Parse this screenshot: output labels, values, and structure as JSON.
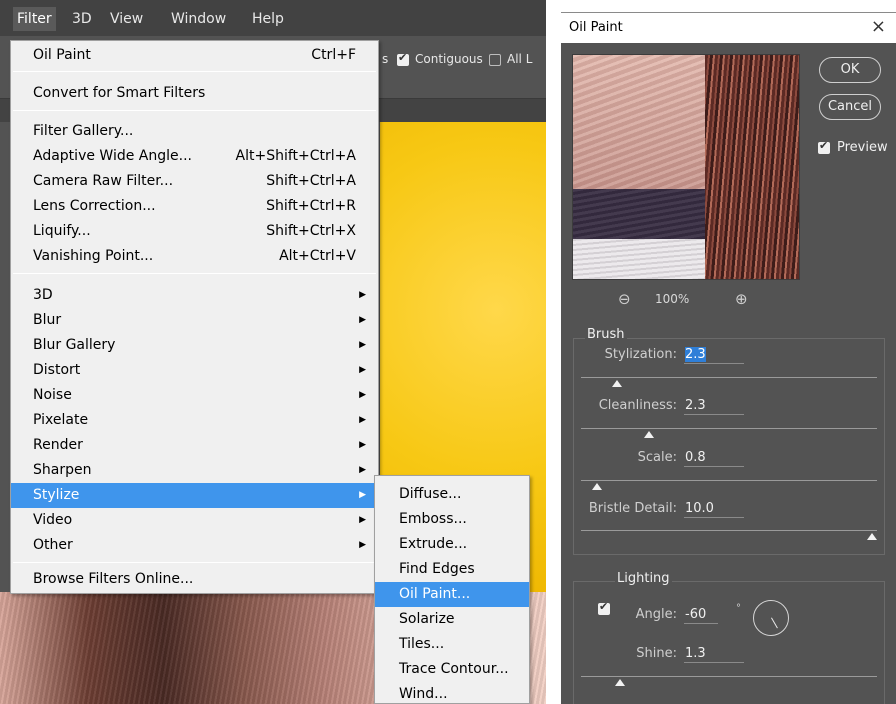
{
  "menubar": {
    "items": [
      "Filter",
      "3D",
      "View",
      "Window",
      "Help"
    ]
  },
  "options_bar": {
    "partial_text": "s",
    "contiguous_label": "Contiguous",
    "all_layers_partial": "All L"
  },
  "filter_menu": {
    "oil_paint": {
      "label": "Oil Paint",
      "shortcut": "Ctrl+F"
    },
    "convert_smart": "Convert for Smart Filters",
    "filter_gallery": "Filter Gallery...",
    "adaptive_wide_angle": {
      "label": "Adaptive Wide Angle...",
      "shortcut": "Alt+Shift+Ctrl+A"
    },
    "camera_raw": {
      "label": "Camera Raw Filter...",
      "shortcut": "Shift+Ctrl+A"
    },
    "lens_correction": {
      "label": "Lens Correction...",
      "shortcut": "Shift+Ctrl+R"
    },
    "liquify": {
      "label": "Liquify...",
      "shortcut": "Shift+Ctrl+X"
    },
    "vanishing_point": {
      "label": "Vanishing Point...",
      "shortcut": "Alt+Ctrl+V"
    },
    "submenus": [
      "3D",
      "Blur",
      "Blur Gallery",
      "Distort",
      "Noise",
      "Pixelate",
      "Render",
      "Sharpen",
      "Stylize",
      "Video",
      "Other"
    ],
    "browse_online": "Browse Filters Online..."
  },
  "stylize_submenu": {
    "items": [
      "Diffuse...",
      "Emboss...",
      "Extrude...",
      "Find Edges",
      "Oil Paint...",
      "Solarize",
      "Tiles...",
      "Trace Contour...",
      "Wind..."
    ]
  },
  "dialog": {
    "title": "Oil Paint",
    "close": "×",
    "ok_label": "OK",
    "cancel_label": "Cancel",
    "preview_label": "Preview",
    "zoom_out_icon": "⊖",
    "zoom_in_icon": "⊕",
    "zoom_level": "100%",
    "brush": {
      "title": "Brush",
      "stylization": {
        "label": "Stylization:",
        "value": "2.3",
        "min": 0.1,
        "max": 10,
        "position": 0.11
      },
      "cleanliness": {
        "label": "Cleanliness:",
        "value": "2.3",
        "min": 0,
        "max": 10,
        "position": 0.22
      },
      "scale": {
        "label": "Scale:",
        "value": "0.8",
        "min": 0.1,
        "max": 10,
        "position": 0.04
      },
      "bristle_detail": {
        "label": "Bristle Detail:",
        "value": "10.0",
        "min": 0,
        "max": 10,
        "position": 1.0
      }
    },
    "lighting": {
      "title": "Lighting",
      "angle": {
        "label": "Angle:",
        "value": "-60",
        "unit": "°"
      },
      "shine": {
        "label": "Shine:",
        "value": "1.3",
        "min": 0,
        "max": 10,
        "position": 0.12
      }
    }
  }
}
